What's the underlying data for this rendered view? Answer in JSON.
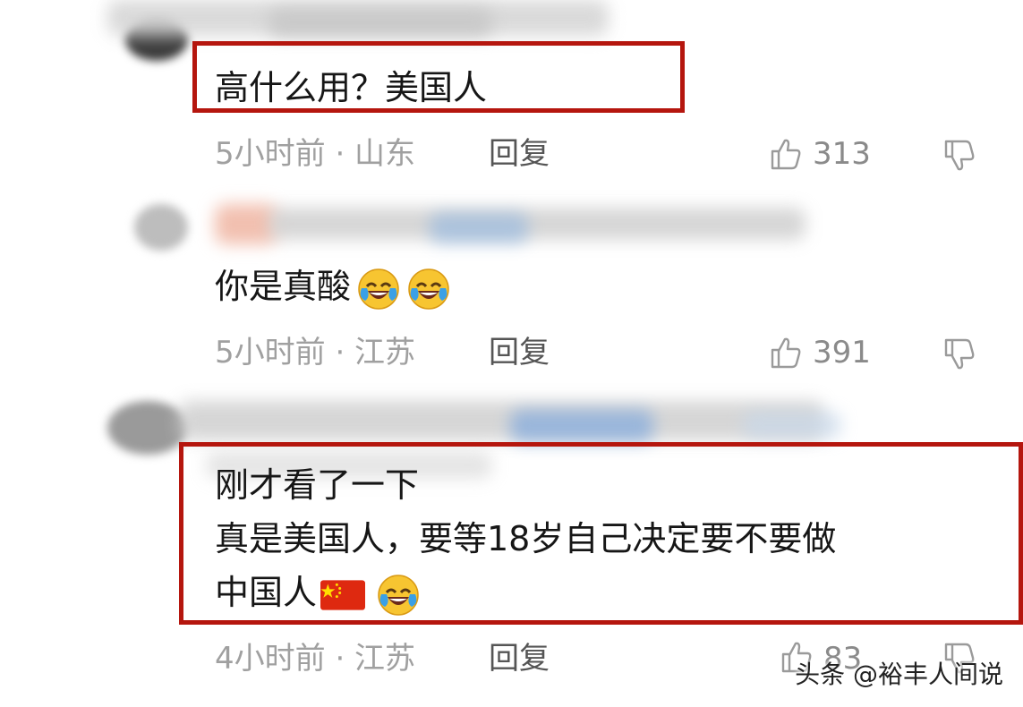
{
  "comments": [
    {
      "lines": [
        "高什么用？美国人"
      ],
      "time_location": "5小时前 · 山东",
      "reply_label": "回复",
      "likes": "313"
    },
    {
      "lines": [
        "你是真酸"
      ],
      "time_location": "5小时前 · 江苏",
      "reply_label": "回复",
      "likes": "391"
    },
    {
      "lines": [
        "刚才看了一下",
        "真是美国人，要等18岁自己决定要不要做",
        "中国人"
      ],
      "time_location": "4小时前 · 江苏",
      "reply_label": "回复",
      "likes": "83"
    }
  ],
  "watermark": "头条 @裕丰人间说",
  "colors": {
    "highlight": "#b5160e",
    "meta_gray": "#a0a0a0",
    "text": "#161616"
  },
  "icons": [
    "thumbs-up-icon",
    "thumbs-down-icon",
    "laughing-crying-emoji",
    "china-flag-emoji"
  ]
}
